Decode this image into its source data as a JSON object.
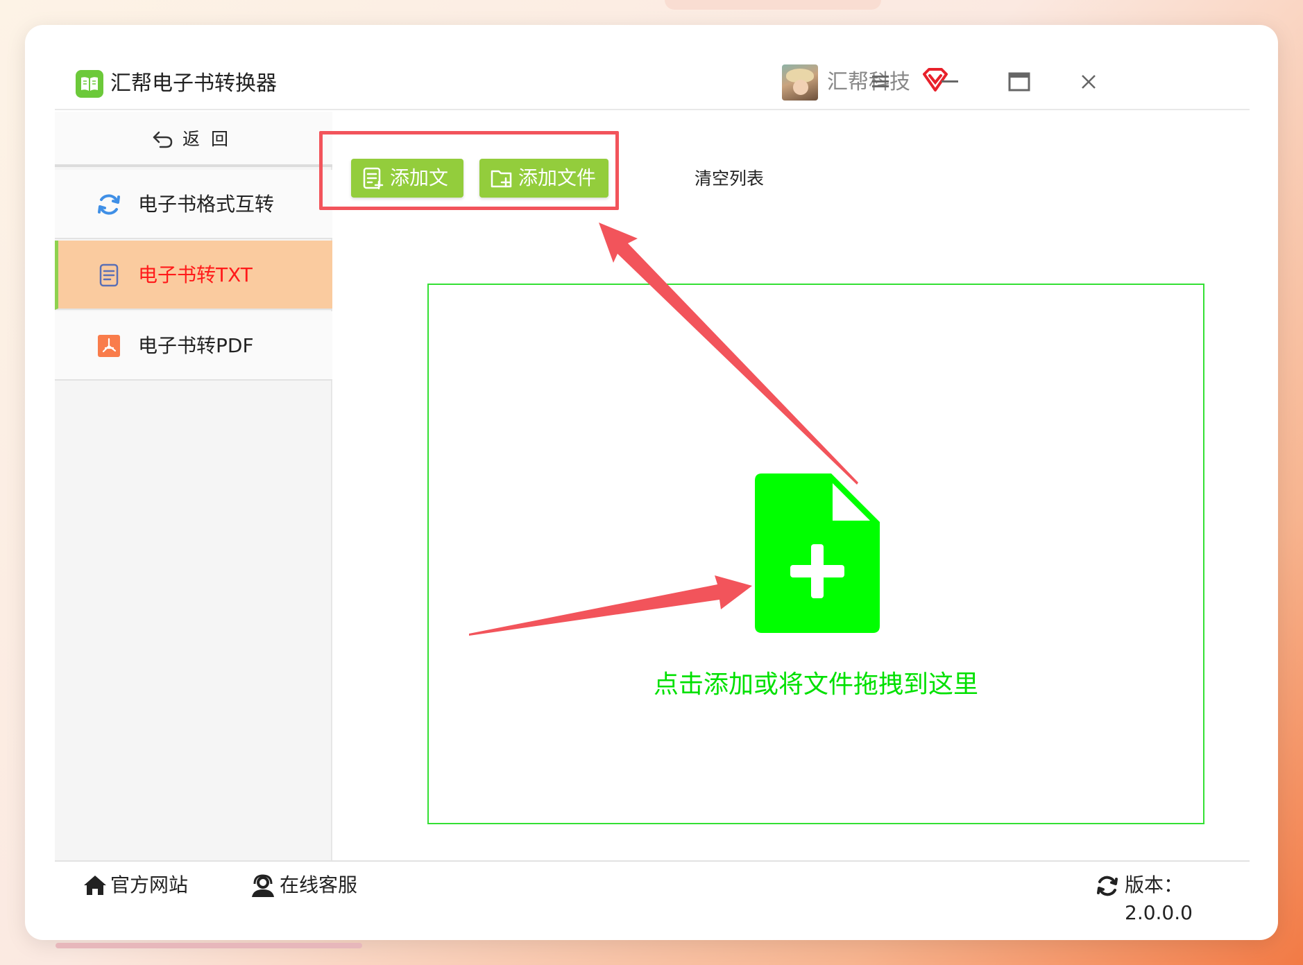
{
  "app": {
    "title": "汇帮电子书转换器",
    "company": "汇帮科技"
  },
  "sidebar": {
    "back_label": "返回",
    "items": [
      {
        "label": "电子书格式互转",
        "icon": "refresh-icon",
        "active": false
      },
      {
        "label": "电子书转TXT",
        "icon": "document-icon",
        "active": true
      },
      {
        "label": "电子书转PDF",
        "icon": "pdf-icon",
        "active": false
      }
    ]
  },
  "toolbar": {
    "add_file": "添加文件",
    "add_folder": "添加文件夹",
    "clear_list": "清空列表"
  },
  "dropzone": {
    "hint": "点击添加或将文件拖拽到这里",
    "icon": "file-add-icon"
  },
  "footer": {
    "website": "官方网站",
    "support": "在线客服",
    "version": "版本：2.0.0.0"
  },
  "colors": {
    "accent_green": "#93cd3c",
    "active_item_bg": "#facb9f",
    "active_item_text": "#ff1a1a",
    "drop_green": "#00ff00",
    "annotation_red": "#f2545b"
  }
}
